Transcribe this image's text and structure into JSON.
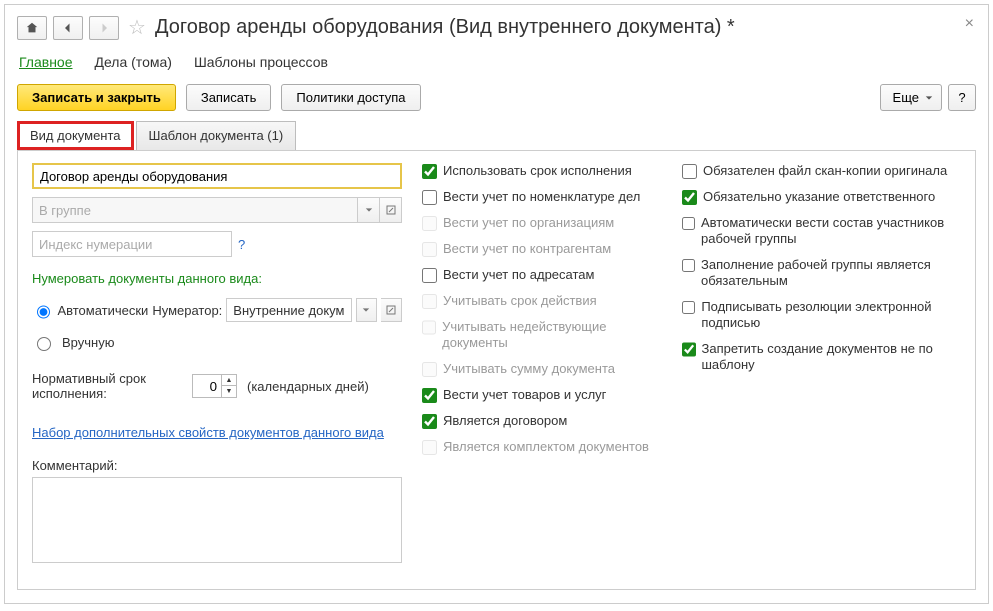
{
  "title": "Договор аренды оборудования (Вид внутреннего документа) *",
  "nav": {
    "main": "Главное",
    "cases": "Дела (тома)",
    "process_templates": "Шаблоны процессов"
  },
  "toolbar": {
    "save_close": "Записать и закрыть",
    "save": "Записать",
    "access_policies": "Политики доступа",
    "more": "Еще",
    "help": "?"
  },
  "tabs": {
    "doc_type": "Вид документа",
    "doc_template": "Шаблон документа (1)"
  },
  "left": {
    "name_value": "Договор аренды оборудования",
    "group_placeholder": "В группе",
    "numbering_index_placeholder": "Индекс нумерации",
    "question": "?",
    "numbering_title": "Нумеровать документы данного вида:",
    "auto_label": "Автоматически",
    "numerator_label": "Нумератор:",
    "numerator_value": "Внутренние докум",
    "manual_label": "Вручную",
    "norm_label": "Нормативный срок исполнения:",
    "norm_value": "0",
    "norm_unit": "(календарных дней)",
    "extra_props_link": "Набор дополнительных свойств документов данного вида",
    "comment_label": "Комментарий:"
  },
  "col_mid": [
    {
      "label": "Использовать срок исполнения",
      "checked": true,
      "disabled": false
    },
    {
      "label": "Вести учет по номенклатуре дел",
      "checked": false,
      "disabled": false
    },
    {
      "label": "Вести учет по организациям",
      "checked": false,
      "disabled": true
    },
    {
      "label": "Вести учет по контрагентам",
      "checked": false,
      "disabled": true
    },
    {
      "label": "Вести учет по адресатам",
      "checked": false,
      "disabled": false
    },
    {
      "label": "Учитывать срок действия",
      "checked": false,
      "disabled": true
    },
    {
      "label": "Учитывать недействующие документы",
      "checked": false,
      "disabled": true
    },
    {
      "label": "Учитывать сумму документа",
      "checked": false,
      "disabled": true
    },
    {
      "label": "Вести учет товаров и услуг",
      "checked": true,
      "disabled": false
    },
    {
      "label": "Является договором",
      "checked": true,
      "disabled": false
    },
    {
      "label": "Является комплектом документов",
      "checked": false,
      "disabled": true
    }
  ],
  "col_right": [
    {
      "label": "Обязателен файл скан-копии оригинала",
      "checked": false,
      "disabled": false
    },
    {
      "label": "Обязательно указание ответственного",
      "checked": true,
      "disabled": false
    },
    {
      "label": "Автоматически вести состав участников рабочей группы",
      "checked": false,
      "disabled": false
    },
    {
      "label": "Заполнение рабочей группы является обязательным",
      "checked": false,
      "disabled": false
    },
    {
      "label": "Подписывать резолюции электронной подписью",
      "checked": false,
      "disabled": false
    },
    {
      "label": "Запретить создание документов не по шаблону",
      "checked": true,
      "disabled": false
    }
  ]
}
